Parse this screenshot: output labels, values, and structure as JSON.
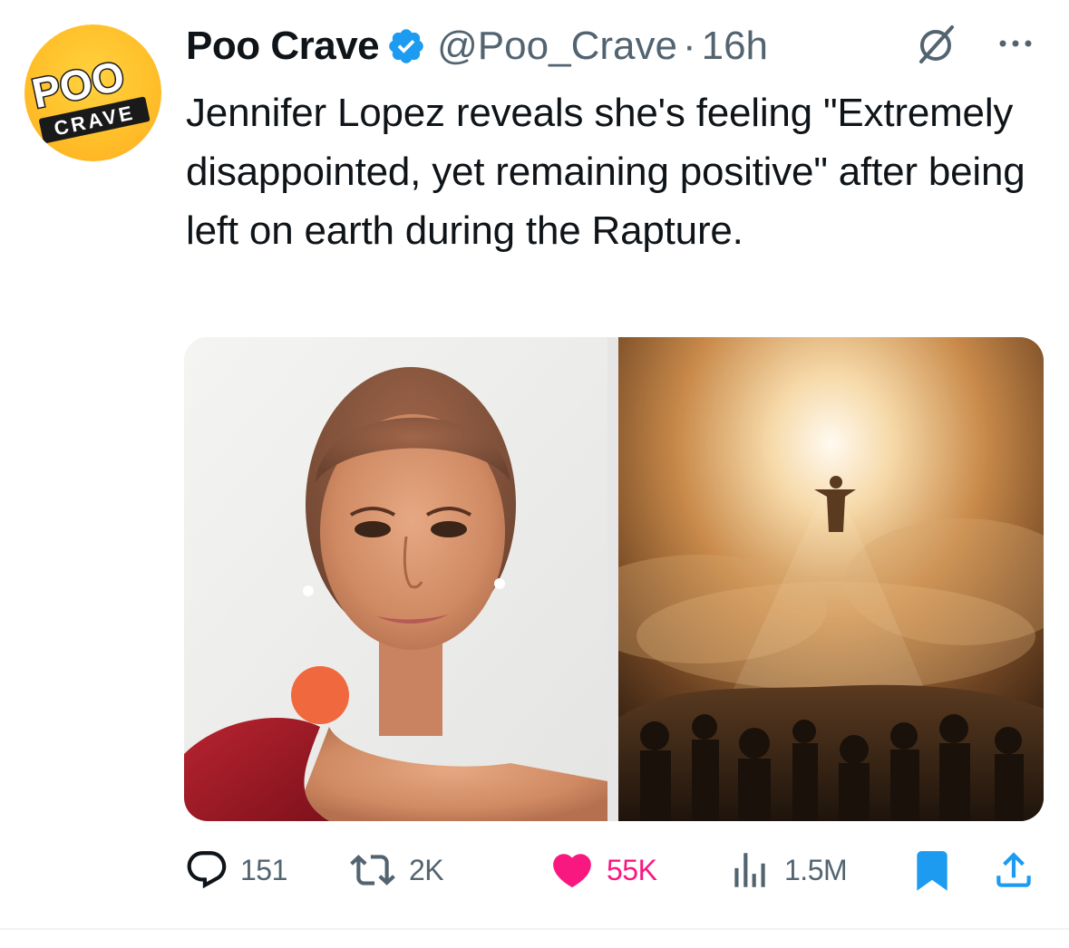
{
  "author": {
    "display_name": "Poo Crave",
    "handle": "@Poo_Crave",
    "separator": "·",
    "time": "16h",
    "avatar_text_top": "POO",
    "avatar_text_bottom": "CRAVE",
    "verified": true
  },
  "tweet": {
    "text": "Jennifer Lopez reveals she's feeling \"Extremely disappointed, yet remaining positive\" after being left on earth during the Rapture."
  },
  "actions": {
    "replies": "151",
    "reposts": "2K",
    "likes": "55K",
    "views": "1.5M"
  },
  "colors": {
    "text": "#0f1419",
    "secondary": "#536471",
    "verified": "#1d9bf0",
    "like": "#f91880",
    "bookmark": "#1d9bf0",
    "avatar_bg": "#ffc02a"
  },
  "icons": [
    "verified-badge-icon",
    "grok-icon",
    "more-icon",
    "reply-icon",
    "repost-icon",
    "like-icon",
    "views-icon",
    "bookmark-icon",
    "share-icon"
  ]
}
